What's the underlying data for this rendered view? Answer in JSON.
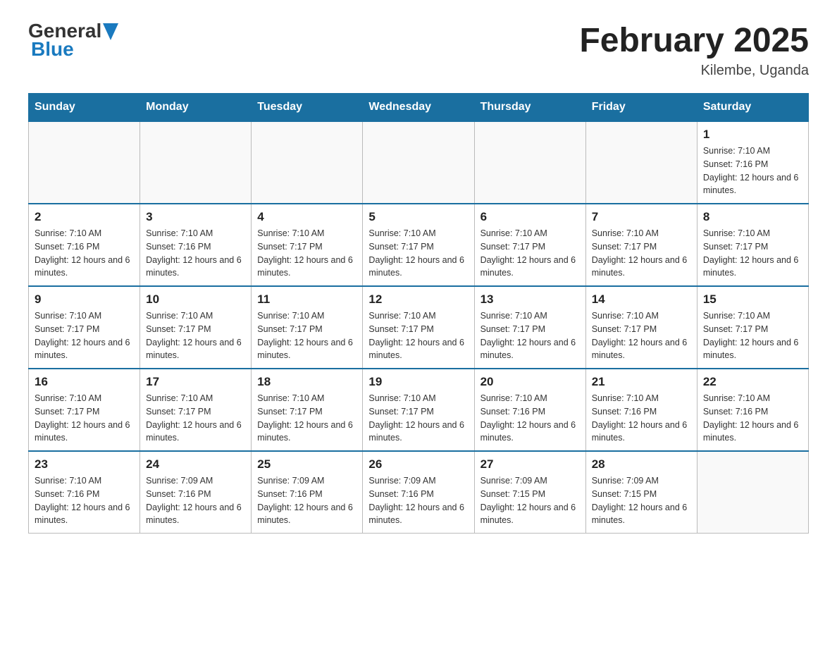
{
  "header": {
    "logo_general": "General",
    "logo_blue": "Blue",
    "title": "February 2025",
    "location": "Kilembe, Uganda"
  },
  "weekdays": [
    "Sunday",
    "Monday",
    "Tuesday",
    "Wednesday",
    "Thursday",
    "Friday",
    "Saturday"
  ],
  "weeks": [
    [
      {
        "day": "",
        "sunrise": "",
        "sunset": "",
        "daylight": ""
      },
      {
        "day": "",
        "sunrise": "",
        "sunset": "",
        "daylight": ""
      },
      {
        "day": "",
        "sunrise": "",
        "sunset": "",
        "daylight": ""
      },
      {
        "day": "",
        "sunrise": "",
        "sunset": "",
        "daylight": ""
      },
      {
        "day": "",
        "sunrise": "",
        "sunset": "",
        "daylight": ""
      },
      {
        "day": "",
        "sunrise": "",
        "sunset": "",
        "daylight": ""
      },
      {
        "day": "1",
        "sunrise": "Sunrise: 7:10 AM",
        "sunset": "Sunset: 7:16 PM",
        "daylight": "Daylight: 12 hours and 6 minutes."
      }
    ],
    [
      {
        "day": "2",
        "sunrise": "Sunrise: 7:10 AM",
        "sunset": "Sunset: 7:16 PM",
        "daylight": "Daylight: 12 hours and 6 minutes."
      },
      {
        "day": "3",
        "sunrise": "Sunrise: 7:10 AM",
        "sunset": "Sunset: 7:16 PM",
        "daylight": "Daylight: 12 hours and 6 minutes."
      },
      {
        "day": "4",
        "sunrise": "Sunrise: 7:10 AM",
        "sunset": "Sunset: 7:17 PM",
        "daylight": "Daylight: 12 hours and 6 minutes."
      },
      {
        "day": "5",
        "sunrise": "Sunrise: 7:10 AM",
        "sunset": "Sunset: 7:17 PM",
        "daylight": "Daylight: 12 hours and 6 minutes."
      },
      {
        "day": "6",
        "sunrise": "Sunrise: 7:10 AM",
        "sunset": "Sunset: 7:17 PM",
        "daylight": "Daylight: 12 hours and 6 minutes."
      },
      {
        "day": "7",
        "sunrise": "Sunrise: 7:10 AM",
        "sunset": "Sunset: 7:17 PM",
        "daylight": "Daylight: 12 hours and 6 minutes."
      },
      {
        "day": "8",
        "sunrise": "Sunrise: 7:10 AM",
        "sunset": "Sunset: 7:17 PM",
        "daylight": "Daylight: 12 hours and 6 minutes."
      }
    ],
    [
      {
        "day": "9",
        "sunrise": "Sunrise: 7:10 AM",
        "sunset": "Sunset: 7:17 PM",
        "daylight": "Daylight: 12 hours and 6 minutes."
      },
      {
        "day": "10",
        "sunrise": "Sunrise: 7:10 AM",
        "sunset": "Sunset: 7:17 PM",
        "daylight": "Daylight: 12 hours and 6 minutes."
      },
      {
        "day": "11",
        "sunrise": "Sunrise: 7:10 AM",
        "sunset": "Sunset: 7:17 PM",
        "daylight": "Daylight: 12 hours and 6 minutes."
      },
      {
        "day": "12",
        "sunrise": "Sunrise: 7:10 AM",
        "sunset": "Sunset: 7:17 PM",
        "daylight": "Daylight: 12 hours and 6 minutes."
      },
      {
        "day": "13",
        "sunrise": "Sunrise: 7:10 AM",
        "sunset": "Sunset: 7:17 PM",
        "daylight": "Daylight: 12 hours and 6 minutes."
      },
      {
        "day": "14",
        "sunrise": "Sunrise: 7:10 AM",
        "sunset": "Sunset: 7:17 PM",
        "daylight": "Daylight: 12 hours and 6 minutes."
      },
      {
        "day": "15",
        "sunrise": "Sunrise: 7:10 AM",
        "sunset": "Sunset: 7:17 PM",
        "daylight": "Daylight: 12 hours and 6 minutes."
      }
    ],
    [
      {
        "day": "16",
        "sunrise": "Sunrise: 7:10 AM",
        "sunset": "Sunset: 7:17 PM",
        "daylight": "Daylight: 12 hours and 6 minutes."
      },
      {
        "day": "17",
        "sunrise": "Sunrise: 7:10 AM",
        "sunset": "Sunset: 7:17 PM",
        "daylight": "Daylight: 12 hours and 6 minutes."
      },
      {
        "day": "18",
        "sunrise": "Sunrise: 7:10 AM",
        "sunset": "Sunset: 7:17 PM",
        "daylight": "Daylight: 12 hours and 6 minutes."
      },
      {
        "day": "19",
        "sunrise": "Sunrise: 7:10 AM",
        "sunset": "Sunset: 7:17 PM",
        "daylight": "Daylight: 12 hours and 6 minutes."
      },
      {
        "day": "20",
        "sunrise": "Sunrise: 7:10 AM",
        "sunset": "Sunset: 7:16 PM",
        "daylight": "Daylight: 12 hours and 6 minutes."
      },
      {
        "day": "21",
        "sunrise": "Sunrise: 7:10 AM",
        "sunset": "Sunset: 7:16 PM",
        "daylight": "Daylight: 12 hours and 6 minutes."
      },
      {
        "day": "22",
        "sunrise": "Sunrise: 7:10 AM",
        "sunset": "Sunset: 7:16 PM",
        "daylight": "Daylight: 12 hours and 6 minutes."
      }
    ],
    [
      {
        "day": "23",
        "sunrise": "Sunrise: 7:10 AM",
        "sunset": "Sunset: 7:16 PM",
        "daylight": "Daylight: 12 hours and 6 minutes."
      },
      {
        "day": "24",
        "sunrise": "Sunrise: 7:09 AM",
        "sunset": "Sunset: 7:16 PM",
        "daylight": "Daylight: 12 hours and 6 minutes."
      },
      {
        "day": "25",
        "sunrise": "Sunrise: 7:09 AM",
        "sunset": "Sunset: 7:16 PM",
        "daylight": "Daylight: 12 hours and 6 minutes."
      },
      {
        "day": "26",
        "sunrise": "Sunrise: 7:09 AM",
        "sunset": "Sunset: 7:16 PM",
        "daylight": "Daylight: 12 hours and 6 minutes."
      },
      {
        "day": "27",
        "sunrise": "Sunrise: 7:09 AM",
        "sunset": "Sunset: 7:15 PM",
        "daylight": "Daylight: 12 hours and 6 minutes."
      },
      {
        "day": "28",
        "sunrise": "Sunrise: 7:09 AM",
        "sunset": "Sunset: 7:15 PM",
        "daylight": "Daylight: 12 hours and 6 minutes."
      },
      {
        "day": "",
        "sunrise": "",
        "sunset": "",
        "daylight": ""
      }
    ]
  ]
}
